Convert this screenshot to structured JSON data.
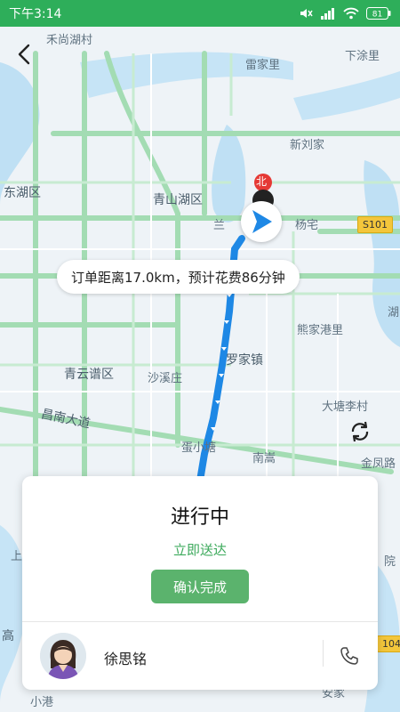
{
  "status_bar": {
    "time": "下午3:14",
    "battery": "81"
  },
  "map": {
    "labels": [
      {
        "id": "hesanghu",
        "text": "禾尚湖村"
      },
      {
        "id": "leijiali",
        "text": "雷家里"
      },
      {
        "id": "xiatuli",
        "text": "下涂里"
      },
      {
        "id": "xinliujia",
        "text": "新刘家"
      },
      {
        "id": "donghu",
        "text": "东湖区"
      },
      {
        "id": "qingshanhu",
        "text": "青山湖区"
      },
      {
        "id": "lanzhi",
        "text": "兰"
      },
      {
        "id": "yangzhai",
        "text": "杨宅"
      },
      {
        "id": "beipoint",
        "text": "北"
      },
      {
        "id": "xiongjiagang",
        "text": "熊家港里"
      },
      {
        "id": "luojiazhen",
        "text": "罗家镇"
      },
      {
        "id": "qingyunpu",
        "text": "青云谱区"
      },
      {
        "id": "shazhuang",
        "text": "沙溪庄"
      },
      {
        "id": "changnan",
        "text": "昌南大道"
      },
      {
        "id": "dajiali",
        "text": "大塘李村"
      },
      {
        "id": "jingshui",
        "text": "蛋小塘"
      },
      {
        "id": "nanshan",
        "text": "南嵩"
      },
      {
        "id": "jinfeng",
        "text": "金凤路"
      },
      {
        "id": "yuan",
        "text": "院"
      },
      {
        "id": "gao",
        "text": "高"
      },
      {
        "id": "shang",
        "text": "上"
      },
      {
        "id": "anjia",
        "text": "安家"
      },
      {
        "id": "xiaonan",
        "text": "小港"
      },
      {
        "id": "hu",
        "text": "湖"
      }
    ],
    "highway_badges": [
      {
        "id": "s101",
        "text": "S101"
      },
      {
        "id": "r104",
        "text": "104"
      }
    ],
    "route_info": "订单距离17.0km，预计花费86分钟"
  },
  "order": {
    "status": "进行中",
    "subtitle": "立即送达",
    "confirm_label": "确认完成",
    "courier_name": "徐思铭"
  },
  "colors": {
    "status_bar": "#2eae5a",
    "route": "#1e88e5",
    "confirm_button": "#5bb36d",
    "accent_text": "#3daa5c"
  }
}
